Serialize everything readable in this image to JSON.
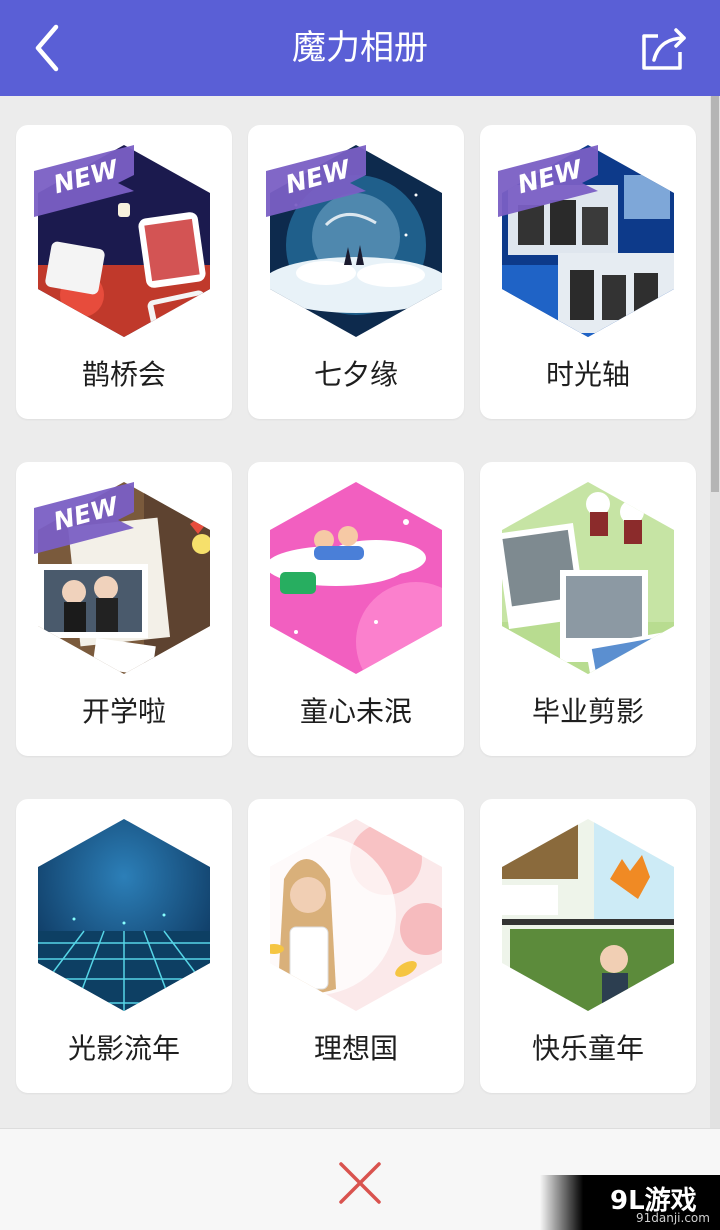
{
  "header": {
    "title": "魔力相册",
    "back_icon": "chevron-left-icon",
    "share_icon": "share-icon",
    "background": "#5a5fd6"
  },
  "badge_text": "NEW",
  "albums": [
    {
      "label": "鹊桥会",
      "is_new": true,
      "theme": "wedding"
    },
    {
      "label": "七夕缘",
      "is_new": true,
      "theme": "night-sky"
    },
    {
      "label": "时光轴",
      "is_new": true,
      "theme": "business"
    },
    {
      "label": "开学啦",
      "is_new": true,
      "theme": "school"
    },
    {
      "label": "童心未泯",
      "is_new": false,
      "theme": "childhood-pink"
    },
    {
      "label": "毕业剪影",
      "is_new": false,
      "theme": "graduation"
    },
    {
      "label": "光影流年",
      "is_new": false,
      "theme": "light-grid"
    },
    {
      "label": "理想国",
      "is_new": false,
      "theme": "dreamland"
    },
    {
      "label": "快乐童年",
      "is_new": false,
      "theme": "happy-kids"
    }
  ],
  "bottom_bar": {
    "close_icon": "close-icon"
  },
  "watermark": {
    "logo": "9L游戏",
    "site": "91danji.com"
  }
}
